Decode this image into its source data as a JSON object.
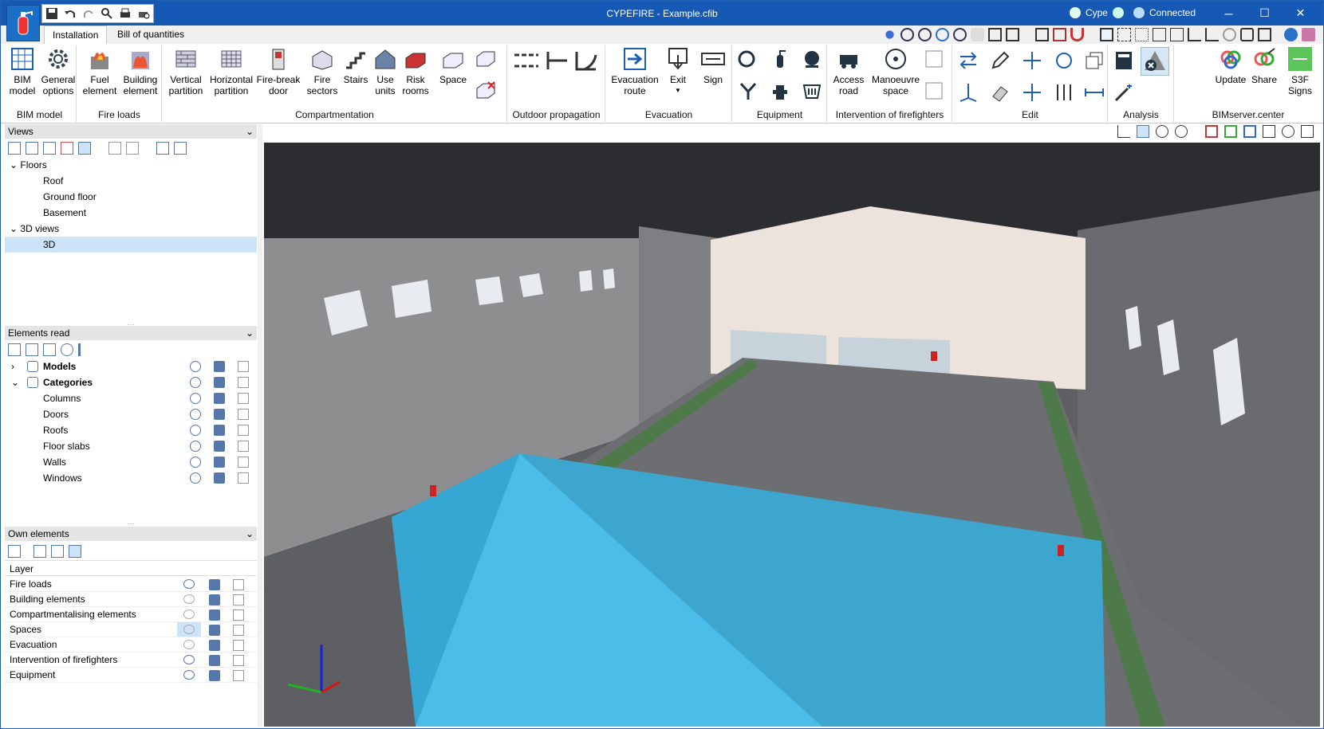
{
  "window": {
    "title": "CYPEFIRE - Example.cfib",
    "user": "Cype",
    "status": "Connected"
  },
  "tabs": [
    "Installation",
    "Bill of quantities"
  ],
  "ribbon": {
    "groups": [
      {
        "name": "BIM model",
        "buttons": [
          {
            "label": "BIM\nmodel"
          },
          {
            "label": "General\noptions"
          }
        ]
      },
      {
        "name": "Fire loads",
        "buttons": [
          {
            "label": "Fuel\nelement"
          },
          {
            "label": "Building\nelement"
          }
        ]
      },
      {
        "name": "Compartmentation",
        "buttons": [
          {
            "label": "Vertical\npartition"
          },
          {
            "label": "Horizontal\npartition"
          },
          {
            "label": "Fire-break\ndoor"
          },
          {
            "label": "Fire\nsectors"
          },
          {
            "label": "Stairs"
          },
          {
            "label": "Use\nunits"
          },
          {
            "label": "Risk\nrooms"
          },
          {
            "label": "Space"
          }
        ]
      },
      {
        "name": "Outdoor propagation",
        "buttons": []
      },
      {
        "name": "Evacuation",
        "buttons": [
          {
            "label": "Evacuation\nroute"
          },
          {
            "label": "Exit"
          },
          {
            "label": "Sign"
          }
        ]
      },
      {
        "name": "Equipment",
        "buttons": []
      },
      {
        "name": "Intervention of firefighters",
        "buttons": [
          {
            "label": "Access\nroad"
          },
          {
            "label": "Manoeuvre\nspace"
          }
        ]
      },
      {
        "name": "Edit",
        "buttons": []
      },
      {
        "name": "Analysis",
        "buttons": []
      },
      {
        "name": "BIMserver.center",
        "buttons": [
          {
            "label": "Update"
          },
          {
            "label": "Share"
          },
          {
            "label": "S3F\nSigns"
          }
        ]
      }
    ]
  },
  "views_panel": {
    "title": "Views",
    "tree": [
      {
        "label": "Floors",
        "level": 0,
        "expanded": true
      },
      {
        "label": "Roof",
        "level": 1
      },
      {
        "label": "Ground floor",
        "level": 1
      },
      {
        "label": "Basement",
        "level": 1
      },
      {
        "label": "3D views",
        "level": 0,
        "expanded": true
      },
      {
        "label": "3D",
        "level": 1,
        "selected": true
      }
    ]
  },
  "elements_panel": {
    "title": "Elements read",
    "rows": [
      {
        "label": "Models",
        "level": 0,
        "bold": true
      },
      {
        "label": "Categories",
        "level": 0,
        "bold": true
      },
      {
        "label": "Columns",
        "level": 1
      },
      {
        "label": "Doors",
        "level": 1
      },
      {
        "label": "Roofs",
        "level": 1
      },
      {
        "label": "Floor slabs",
        "level": 1
      },
      {
        "label": "Walls",
        "level": 1
      },
      {
        "label": "Windows",
        "level": 1
      }
    ]
  },
  "own_panel": {
    "title": "Own elements",
    "header": "Layer",
    "rows": [
      {
        "label": "Fire loads",
        "visible": true
      },
      {
        "label": "Building elements",
        "visible": false
      },
      {
        "label": "Compartmentalising elements",
        "visible": false
      },
      {
        "label": "Spaces",
        "visible": false,
        "highlighted": true
      },
      {
        "label": "Evacuation",
        "visible": false
      },
      {
        "label": "Intervention of firefighters",
        "visible": true
      },
      {
        "label": "Equipment",
        "visible": true
      }
    ]
  },
  "colors": {
    "titlebar": "#1559b5",
    "space_fill": "#4bbde8",
    "selection": "#cde3f7"
  }
}
